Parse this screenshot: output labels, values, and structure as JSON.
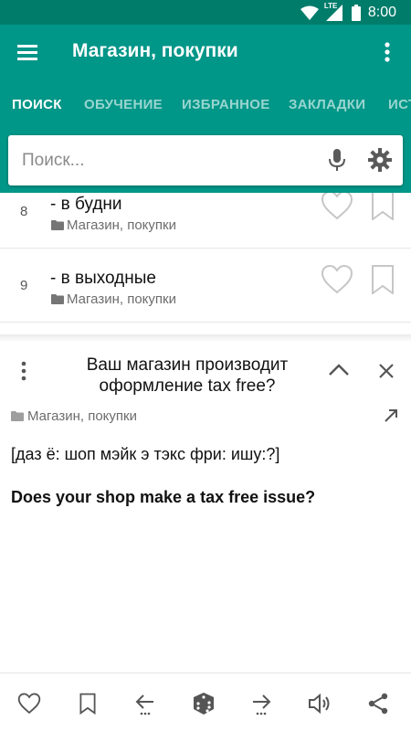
{
  "status_bar": {
    "time": "8:00",
    "network_label": "LTE",
    "icons": [
      "wifi-icon",
      "lte-signal-icon",
      "battery-icon"
    ]
  },
  "app_bar": {
    "title": "Магазин, покупки",
    "menu_icon": "hamburger-menu-icon",
    "more_icon": "more-vertical-icon"
  },
  "tabs": [
    {
      "label": "ПОИСК",
      "active": true
    },
    {
      "label": "ОБУЧЕНИЕ",
      "active": false
    },
    {
      "label": "ИЗБРАННОЕ",
      "active": false
    },
    {
      "label": "ЗАКЛАДКИ",
      "active": false
    },
    {
      "label": "ИСТ",
      "active": false
    }
  ],
  "search": {
    "placeholder": "Поиск...",
    "mic_icon": "microphone-icon",
    "settings_icon": "gear-icon"
  },
  "list": {
    "items": [
      {
        "number": "8",
        "text": "- в будни",
        "category": "Магазин, покупки"
      },
      {
        "number": "9",
        "text": "- в выходные",
        "category": "Магазин, покупки"
      }
    ]
  },
  "detail": {
    "phrase": "Ваш магазин производит оформление tax free?",
    "category": "Магазин, покупки",
    "transcription": "[даз ё: шоп мэйк э тэкс фри: ишу:?]",
    "translation": "Does your shop make a tax free issue?"
  },
  "bottom_bar": {
    "icons": [
      "heart-icon",
      "bookmark-icon",
      "previous-icon",
      "random-dice-icon",
      "next-icon",
      "speaker-icon",
      "share-icon"
    ]
  },
  "colors": {
    "primary": "#009688",
    "primary_dark": "#007c6a",
    "icon_gray": "#b0b0b0",
    "text": "#111111"
  }
}
